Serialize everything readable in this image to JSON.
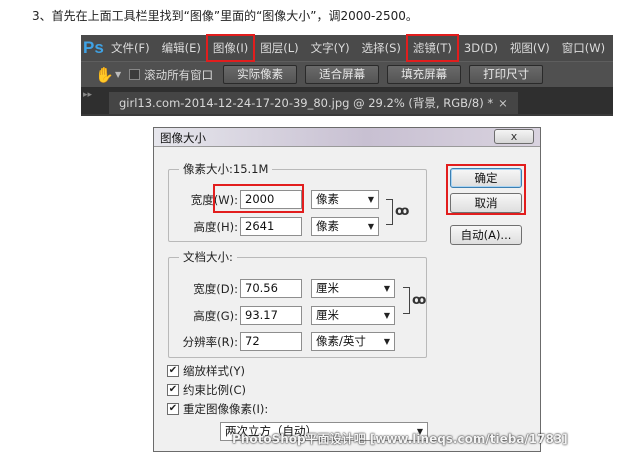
{
  "instruction": "3、首先在上面工具栏里找到“图像”里面的“图像大小”，调2000-2500。",
  "photoshop": {
    "logo": "Ps",
    "menu": [
      "文件(F)",
      "编辑(E)",
      "图像(I)",
      "图层(L)",
      "文字(Y)",
      "选择(S)",
      "滤镜(T)",
      "3D(D)",
      "视图(V)",
      "窗口(W)"
    ],
    "options": {
      "scroll_all_label": "滚动所有窗口",
      "buttons": [
        "实际像素",
        "适合屏幕",
        "填充屏幕",
        "打印尺寸"
      ]
    },
    "doc_tab": "girl13.com-2014-12-24-17-20-39_80.jpg @ 29.2% (背景, RGB/8) *",
    "doc_tab_close": "×"
  },
  "dialog": {
    "title": "图像大小",
    "close": "x",
    "pixel_dims": {
      "legend": "像素大小:15.1M",
      "width_label": "宽度(W):",
      "width_value": "2000",
      "width_unit": "像素",
      "height_label": "高度(H):",
      "height_value": "2641",
      "height_unit": "像素"
    },
    "doc_size": {
      "legend": "文档大小:",
      "width_label": "宽度(D):",
      "width_value": "70.56",
      "width_unit": "厘米",
      "height_label": "高度(G):",
      "height_value": "93.17",
      "height_unit": "厘米",
      "res_label": "分辨率(R):",
      "res_value": "72",
      "res_unit": "像素/英寸"
    },
    "buttons": {
      "ok": "确定",
      "cancel": "取消",
      "auto": "自动(A)..."
    },
    "checkboxes": {
      "scale_styles": "缩放样式(Y)",
      "constrain": "约束比例(C)",
      "resample": "重定图像像素(I):"
    },
    "resample_method": "两次立方（自动）"
  },
  "watermark": "PhotoShop平面设计吧 [www.lineqs.com/tieba/1783]",
  "colors": {
    "highlight": "#e21d1d",
    "ps_logo": "#3fa3e6"
  }
}
